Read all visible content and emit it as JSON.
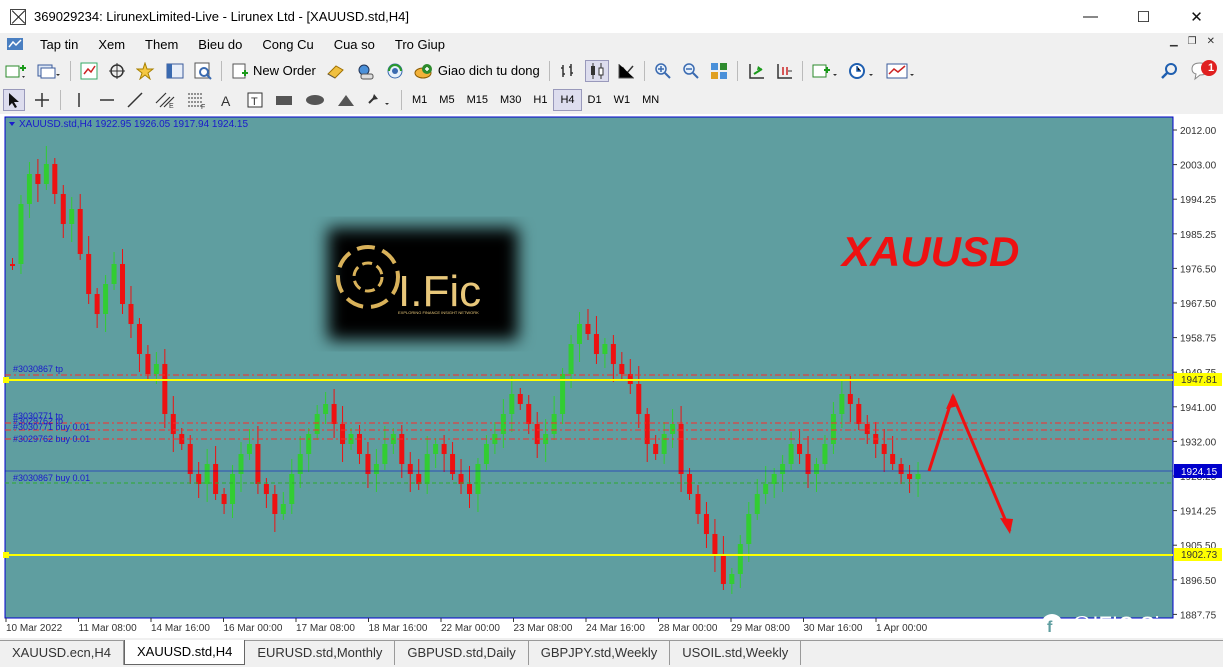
{
  "window": {
    "title": "369029234: LirunexLimited-Live - Lirunex Ltd - [XAUUSD.std,H4]",
    "controls": [
      "—",
      "☐",
      "✕"
    ]
  },
  "menu": [
    "Tap tin",
    "Xem",
    "Them",
    "Bieu do",
    "Cong Cu",
    "Cua so",
    "Tro Giup"
  ],
  "toolbar": {
    "new_order": "New Order",
    "auto_trading": "Giao dich tu dong",
    "notifications": "1"
  },
  "timeframes": [
    "M1",
    "M5",
    "M15",
    "M30",
    "H1",
    "H4",
    "D1",
    "W1",
    "MN"
  ],
  "active_timeframe": "H4",
  "chart": {
    "header": "XAUUSD.std,H4  1922.95 1926.05 1917.94 1924.15",
    "symbol_watermark": "XAUUSD",
    "logo_text": "I.Fic",
    "logo_tagline": "EXPLORING FINANCE INSIGHT NETWORK",
    "social": "@IFIC Signal",
    "order_labels": [
      "#3030867 tp",
      "#3030771 tp",
      "#3029762 tp",
      "#3030771 buy 0.01",
      "#3029762 buy 0.01",
      "#3030867 buy 0.01"
    ],
    "price_labels": [
      "2012.00",
      "2003.00",
      "1994.25",
      "1985.25",
      "1976.50",
      "1967.50",
      "1958.75",
      "1949.75",
      "1941.00",
      "1932.00",
      "1923.25",
      "1914.25",
      "1905.50",
      "1896.50",
      "1887.75"
    ],
    "level_labels": [
      "1947.81",
      "1924.15",
      "1902.73"
    ],
    "time_labels": [
      "10 Mar 2022",
      "11 Mar 08:00",
      "14 Mar 16:00",
      "16 Mar 00:00",
      "17 Mar 08:00",
      "18 Mar 16:00",
      "22 Mar 00:00",
      "23 Mar 08:00",
      "24 Mar 16:00",
      "28 Mar 00:00",
      "29 Mar 08:00",
      "30 Mar 16:00",
      "1 Apr 00:00"
    ],
    "colors": {
      "background": "#5f9ea0",
      "bull": "#32cd32",
      "bear": "#ee1111",
      "level": "#ffff00",
      "order": "#ff2a2a",
      "current_price": "#0000cc"
    }
  },
  "tabs": [
    "XAUUSD.ecn,H4",
    "XAUUSD.std,H4",
    "EURUSD.std,Monthly",
    "GBPUSD.std,Daily",
    "GBPJPY.std,Weekly",
    "USOIL.std,Weekly"
  ],
  "active_tab": "XAUUSD.std,H4"
}
